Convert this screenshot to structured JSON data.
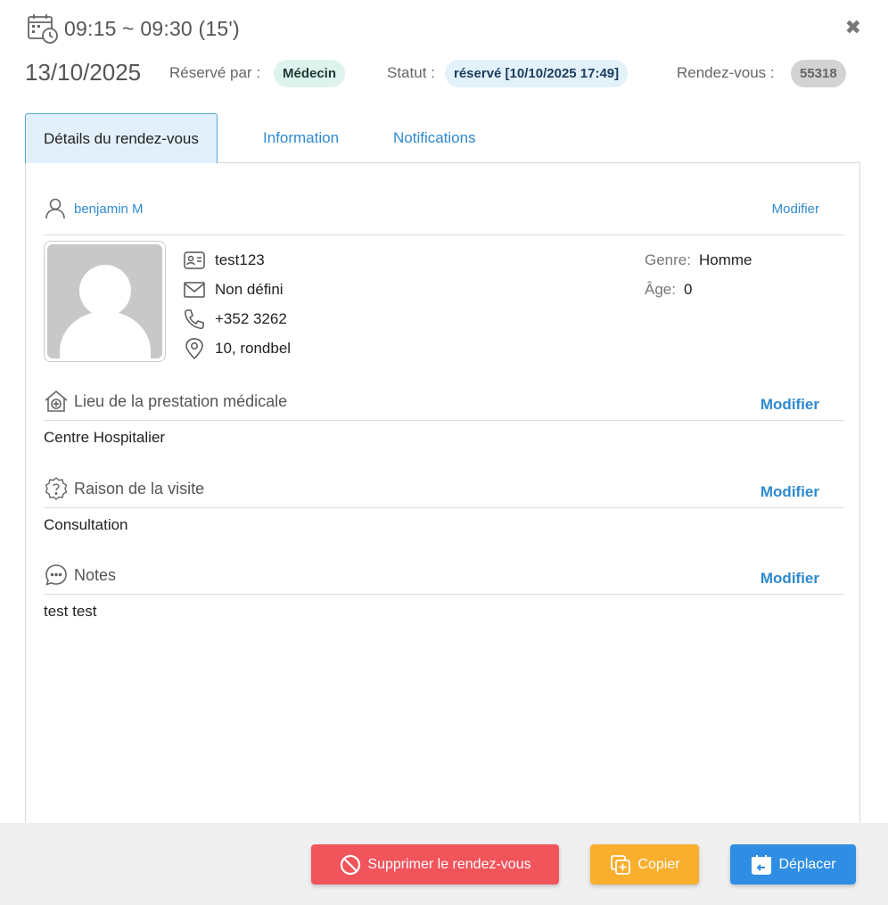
{
  "header": {
    "time_range": "09:15 ~ 09:30 (15')",
    "date": "13/10/2025",
    "reserved_by_label": "Réservé par :",
    "reserved_by_value": "Médecin",
    "status_label": "Statut :",
    "status_value": "réservé [10/10/2025 17:49]",
    "appointment_label": "Rendez-vous :",
    "appointment_value": "55318",
    "close_icon": "✖"
  },
  "tabs": [
    {
      "label": "Détails du rendez-vous",
      "active": true
    },
    {
      "label": "Information",
      "active": false
    },
    {
      "label": "Notifications",
      "active": false
    }
  ],
  "patient": {
    "name": "benjamin M",
    "modify_label": "Modifier",
    "id": "test123",
    "email": "Non défini",
    "phone": "+352 3262",
    "address": "10, rondbel",
    "gender_label": "Genre:",
    "gender_value": "Homme",
    "age_label": "Âge:",
    "age_value": "0"
  },
  "sections": {
    "location": {
      "title": "Lieu de la prestation médicale",
      "modify_label": "Modifier",
      "value": "Centre Hospitalier"
    },
    "reason": {
      "title": "Raison de la visite",
      "modify_label": "Modifier",
      "value": "Consultation"
    },
    "notes": {
      "title": "Notes",
      "modify_label": "Modifier",
      "value": "test test"
    }
  },
  "footer": {
    "delete_label": "Supprimer le rendez-vous",
    "copy_label": "Copier",
    "move_label": "Déplacer"
  },
  "colors": {
    "accent": "#2f8ad0",
    "delete": "#f2545b",
    "copy": "#f9ae2d",
    "move": "#2f8ee3"
  }
}
